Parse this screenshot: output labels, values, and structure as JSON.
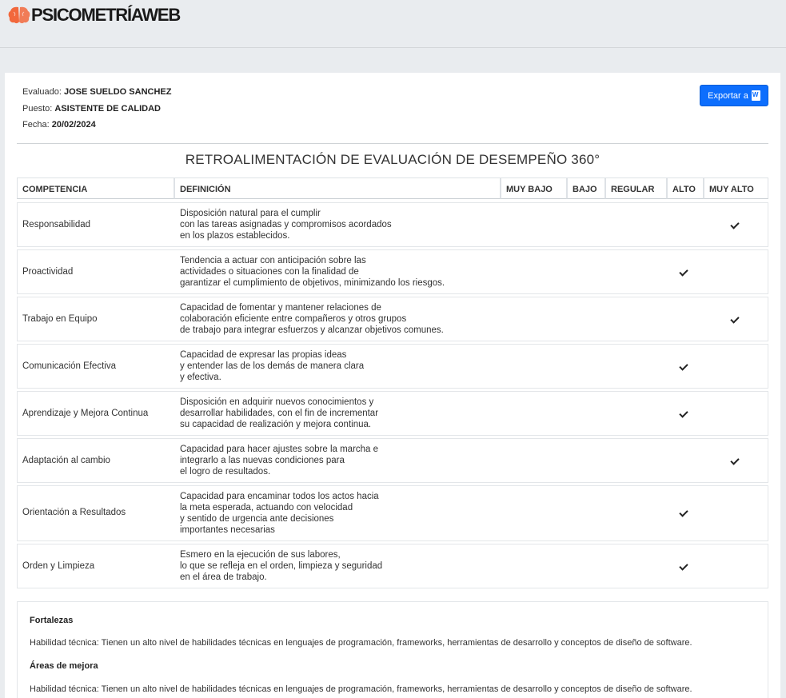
{
  "app": {
    "logo_text": "PSICOMETRÍAWEB"
  },
  "evaluation": {
    "evaluado_label": "Evaluado:",
    "evaluado": "JOSE SUELDO SANCHEZ",
    "puesto_label": "Puesto:",
    "puesto": "ASISTENTE DE CALIDAD",
    "fecha_label": "Fecha:",
    "fecha": "20/02/2024"
  },
  "toolbar": {
    "export_label": "Exportar a",
    "export_icon": "word-document-icon"
  },
  "report": {
    "title": "RETROALIMENTACIÓN DE EVALUACIÓN DE DESEMPEÑO 360°"
  },
  "table": {
    "headers": [
      "COMPETENCIA",
      "DEFINICIÓN",
      "MUY BAJO",
      "BAJO",
      "REGULAR",
      "ALTO",
      "MUY ALTO"
    ],
    "rows": [
      {
        "competencia": "Responsabilidad",
        "definicion": "Disposición natural para el cumplir\ncon las tareas asignadas y compromisos acordados\nen los plazos establecidos.",
        "nivel": "MUY ALTO"
      },
      {
        "competencia": "Proactividad",
        "definicion": "Tendencia a actuar con anticipación sobre las\nactividades o situaciones con la finalidad de\ngarantizar el cumplimiento de objetivos, minimizando los riesgos.",
        "nivel": "ALTO"
      },
      {
        "competencia": "Trabajo en Equipo",
        "definicion": "Capacidad de fomentar y mantener relaciones de\ncolaboración eficiente entre compañeros y otros grupos\nde trabajo para integrar esfuerzos y alcanzar objetivos comunes.",
        "nivel": "MUY ALTO"
      },
      {
        "competencia": "Comunicación Efectiva",
        "definicion": "Capacidad de expresar las propias ideas\ny entender las de los demás de manera clara\ny efectiva.",
        "nivel": "ALTO"
      },
      {
        "competencia": "Aprendizaje y Mejora Continua",
        "definicion": "Disposición en adquirir nuevos conocimientos y\ndesarrollar habilidades, con el fin de incrementar\nsu capacidad de realización y mejora continua.",
        "nivel": "ALTO"
      },
      {
        "competencia": "Adaptación al cambio",
        "definicion": "Capacidad para hacer ajustes sobre la marcha e\nintegrarlo a las nuevas condiciones para\nel logro de resultados.",
        "nivel": "MUY ALTO"
      },
      {
        "competencia": "Orientación a Resultados",
        "definicion": "Capacidad para encaminar todos los actos hacia\nla meta esperada, actuando con velocidad\ny sentido de urgencia ante decisiones\nimportantes necesarias",
        "nivel": "ALTO"
      },
      {
        "competencia": "Orden y Limpieza",
        "definicion": "Esmero en la ejecución de sus labores,\nlo que se refleja en el orden, limpieza y seguridad\nen el área de trabajo.",
        "nivel": "ALTO"
      }
    ]
  },
  "summary": {
    "fortalezas_title": "Fortalezas",
    "fortalezas_text": "Habilidad técnica: Tienen un alto nivel de habilidades técnicas en lenguajes de programación, frameworks, herramientas de desarrollo y conceptos de diseño de software.",
    "mejora_title": "Áreas de mejora",
    "mejora_text": "Habilidad técnica: Tienen un alto nivel de habilidades técnicas en lenguajes de programación, frameworks, herramientas de desarrollo y conceptos de diseño de software."
  },
  "colors": {
    "accent": "#0d6efd",
    "logo_orange": "#f2683c",
    "background": "#e9ecef"
  }
}
